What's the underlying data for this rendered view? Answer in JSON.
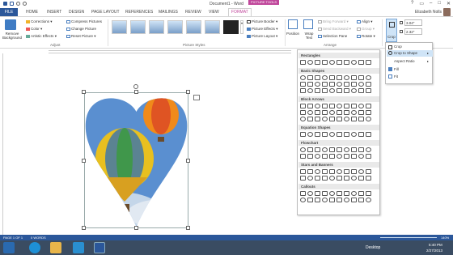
{
  "window": {
    "title": "Document1 - Word",
    "context_tab_label": "PICTURE TOOLS",
    "user": "Elizabeth Nolls"
  },
  "tabs": [
    "FILE",
    "HOME",
    "INSERT",
    "DESIGN",
    "PAGE LAYOUT",
    "REFERENCES",
    "MAILINGS",
    "REVIEW",
    "VIEW",
    "FORMAT"
  ],
  "ribbon": {
    "remove_background": "Remove Background",
    "adjust": {
      "corrections": "Corrections",
      "color": "Color",
      "artistic": "Artistic Effects",
      "compress": "Compress Pictures",
      "change": "Change Picture",
      "reset": "Reset Picture",
      "label": "Adjust"
    },
    "styles": {
      "label": "Picture Styles",
      "border": "Picture Border",
      "effects": "Picture Effects",
      "layout": "Picture Layout"
    },
    "arrange": {
      "label": "Arrange",
      "position": "Position",
      "wrap": "Wrap Text",
      "bring": "Bring Forward",
      "send": "Send Backward",
      "selection": "Selection Pane",
      "align": "Align",
      "group": "Group",
      "rotate": "Rotate"
    },
    "size": {
      "crop": "Crop",
      "height": "3.04\"",
      "width": "2.32\""
    }
  },
  "crop_menu": {
    "items": [
      "Crop",
      "Crop to Shape",
      "Aspect Ratio",
      "Fill",
      "Fit"
    ]
  },
  "shapes_panel": {
    "sections": [
      "Rectangles",
      "Basic Shapes",
      "Block Arrows",
      "Equation Shapes",
      "Flowchart",
      "Stars and Banners",
      "Callouts"
    ]
  },
  "status": {
    "page": "PAGE 1 OF 1",
    "words": "0 WORDS",
    "zoom": "140%"
  },
  "taskbar": {
    "desktop": "Desktop",
    "time": "5:40 PM",
    "date": "2/27/2013"
  }
}
